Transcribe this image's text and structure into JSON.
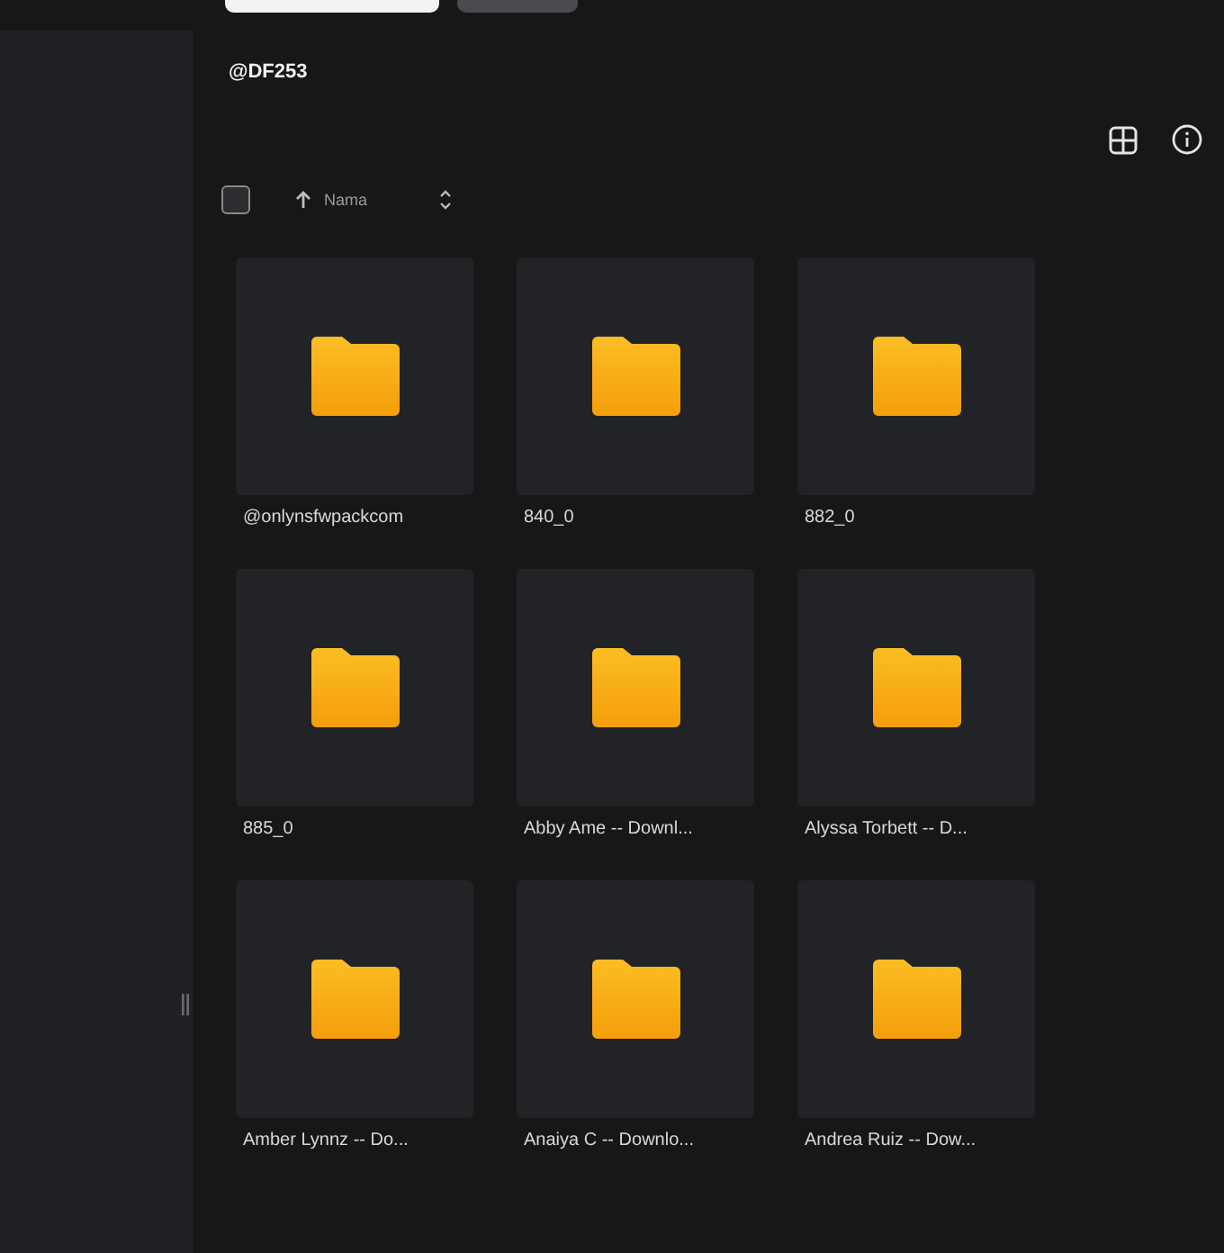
{
  "breadcrumb": "@DF253",
  "toolbar": {
    "select_all": {
      "checked": false
    },
    "sort": {
      "label": "Nama",
      "ascending": true
    }
  },
  "folders": [
    {
      "name": "@onlynsfwpackcom"
    },
    {
      "name": "840_0"
    },
    {
      "name": "882_0"
    },
    {
      "name": "885_0"
    },
    {
      "name": "Abby Ame -- Downl..."
    },
    {
      "name": "Alyssa Torbett -- D..."
    },
    {
      "name": "Amber Lynnz -- Do..."
    },
    {
      "name": "Anaiya C -- Downlo..."
    },
    {
      "name": "Andrea Ruiz -- Dow..."
    }
  ]
}
